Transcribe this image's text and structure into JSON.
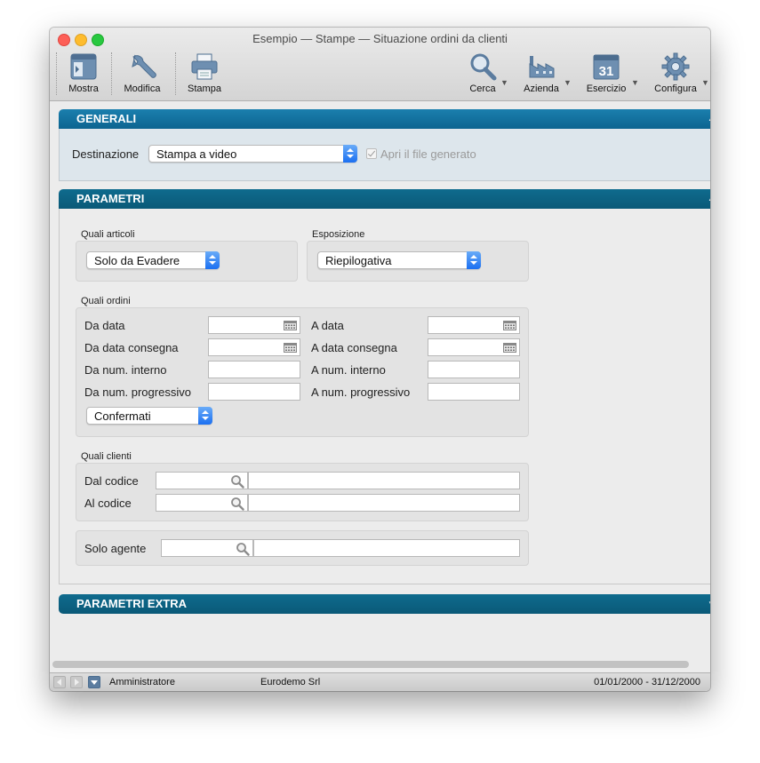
{
  "window": {
    "title": "Esempio — Stampe — Situazione ordini da clienti"
  },
  "toolbar": {
    "mostra": "Mostra",
    "modifica": "Modifica",
    "stampa": "Stampa",
    "cerca": "Cerca",
    "azienda": "Azienda",
    "esercizio": "Esercizio",
    "esercizio_day": "31",
    "configura": "Configura"
  },
  "generali": {
    "title": "GENERALI",
    "destinazione_label": "Destinazione",
    "destinazione_value": "Stampa a video",
    "apri_file_label": "Apri il file generato"
  },
  "parametri": {
    "title": "PARAMETRI",
    "quali_articoli_label": "Quali articoli",
    "quali_articoli_value": "Solo da Evadere",
    "esposizione_label": "Esposizione",
    "esposizione_value": "Riepilogativa",
    "quali_ordini_label": "Quali ordini",
    "da_data": "Da data",
    "a_data": "A data",
    "da_data_consegna": "Da data consegna",
    "a_data_consegna": "A data consegna",
    "da_num_interno": "Da num. interno",
    "a_num_interno": "A num. interno",
    "da_num_progressivo": "Da num. progressivo",
    "a_num_progressivo": "A num. progressivo",
    "stato_ordini_value": "Confermati",
    "quali_clienti_label": "Quali clienti",
    "dal_codice": "Dal codice",
    "al_codice": "Al codice",
    "solo_agente": "Solo agente"
  },
  "parametri_extra": {
    "title": "PARAMETRI EXTRA"
  },
  "statusbar": {
    "user": "Amministratore",
    "company": "Eurodemo Srl",
    "period": "01/01/2000 - 31/12/2000"
  },
  "colors": {
    "section_header": "#0c6490",
    "accent_blue": "#1b6ff1"
  }
}
